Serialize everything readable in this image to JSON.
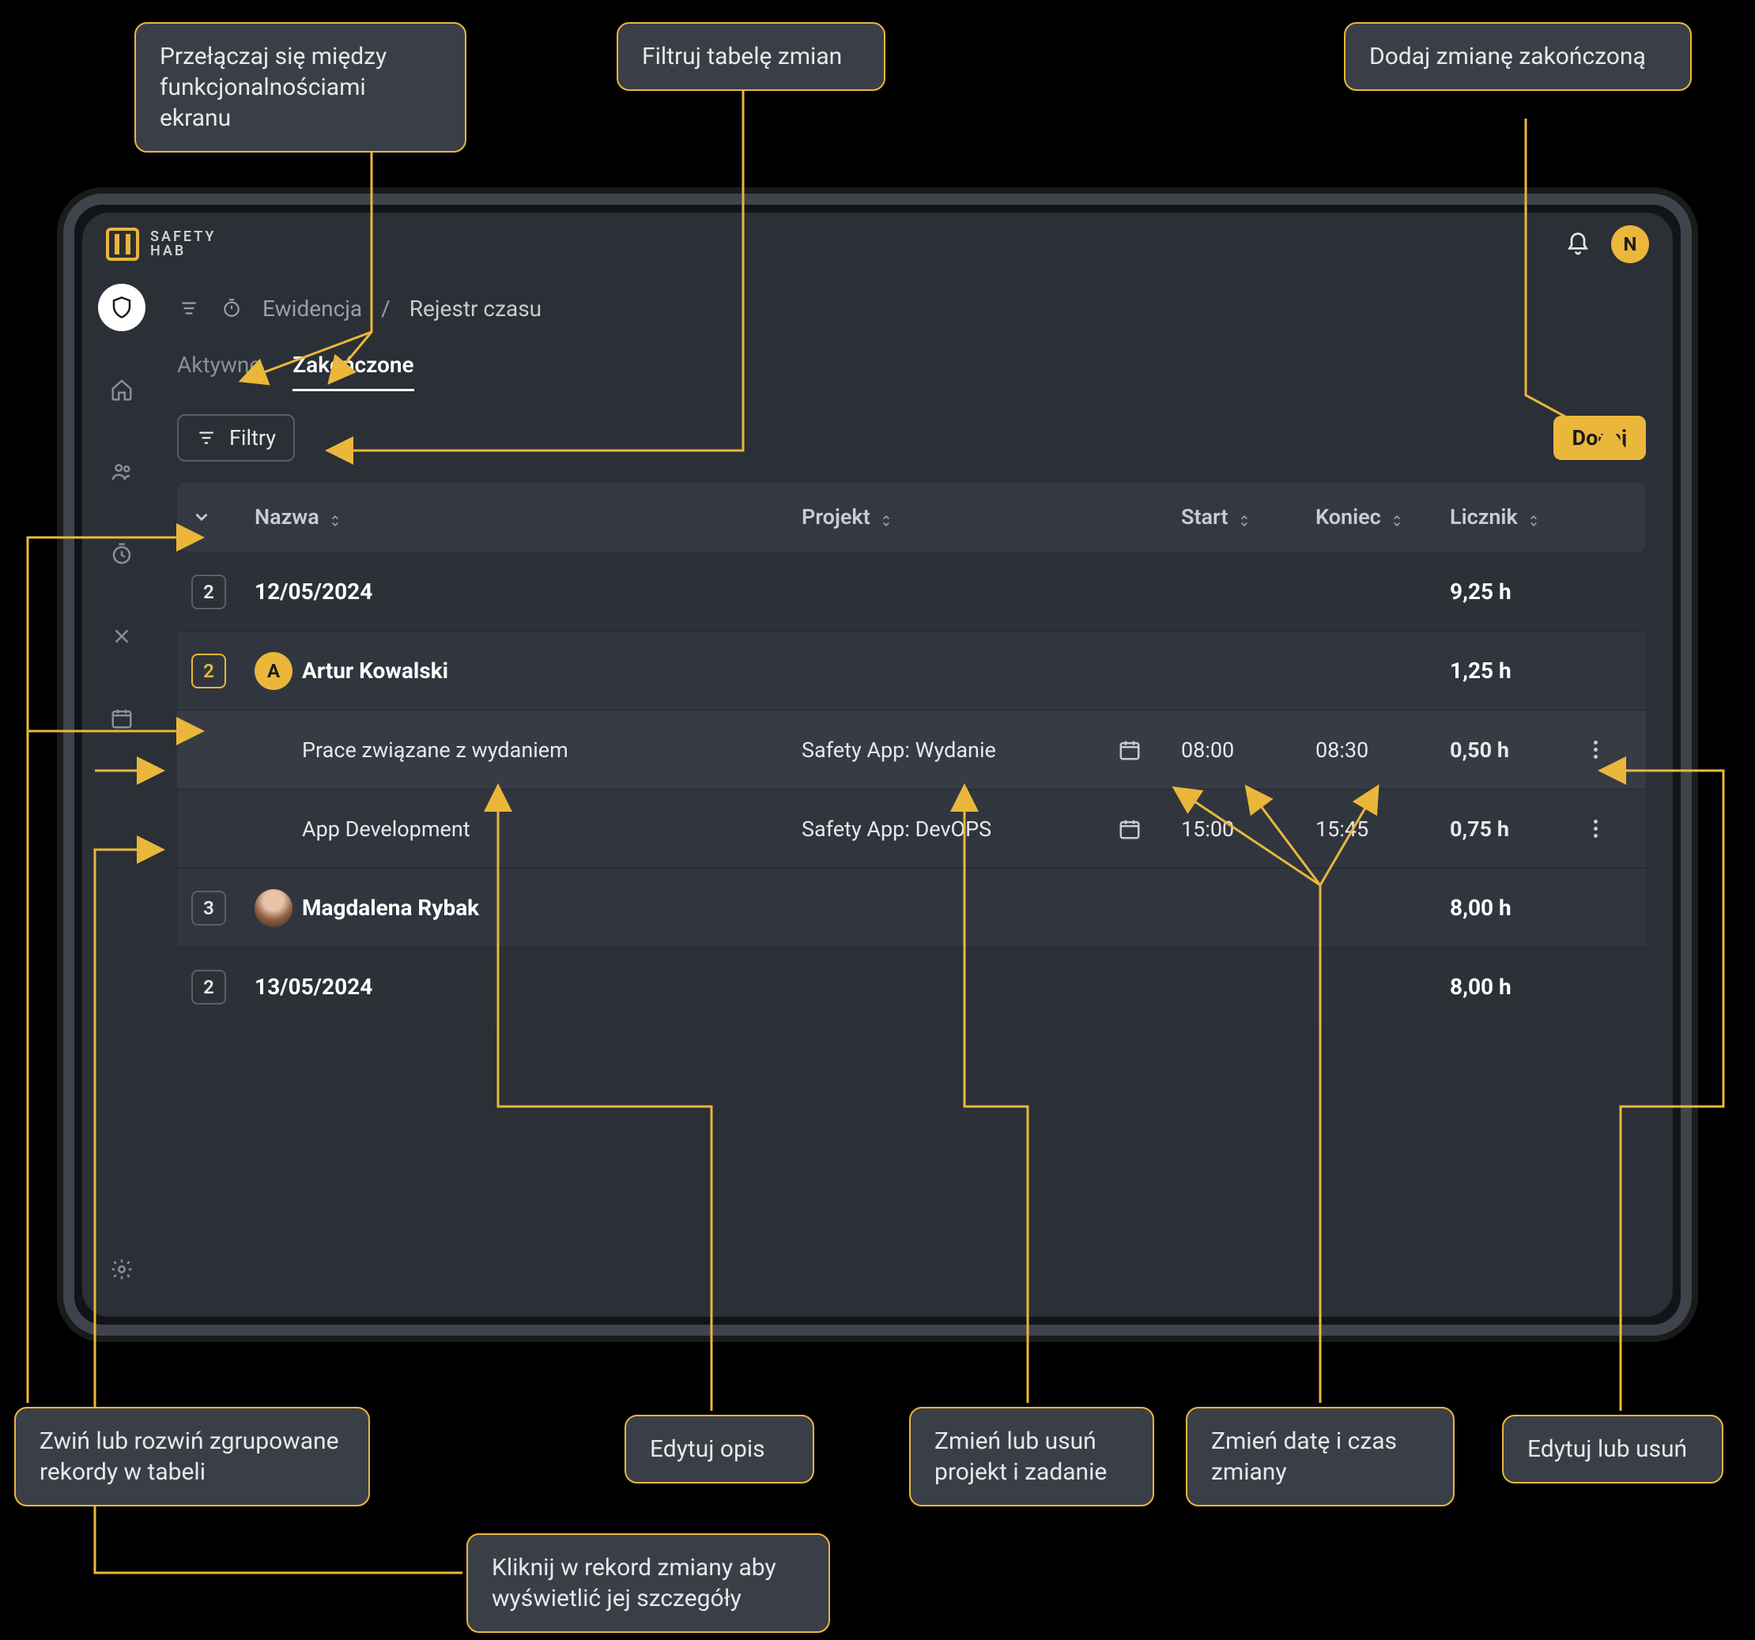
{
  "callouts": {
    "switch_tabs": "Przełączaj się między funkcjonalnościami ekranu",
    "filter": "Filtruj tabelę zmian",
    "add": "Dodaj zmianę zakończoną",
    "collapse": "Zwiń lub rozwiń zgrupowane rekordy w tabeli",
    "edit_desc": "Edytuj opis",
    "change_proj": "Zmień lub usuń projekt i zadanie",
    "change_date": "Zmień datę i czas zmiany",
    "edit_delete": "Edytuj lub usuń",
    "click_record": "Kliknij w rekord zmiany aby wyświetlić jej szczegóły"
  },
  "appbar": {
    "brand1": "SAFETY",
    "brand2": "HAB",
    "user_initial": "N"
  },
  "breadcrumb": {
    "a": "Ewidencja",
    "b": "Rejestr czasu"
  },
  "tabs": {
    "active": "Aktywne",
    "done": "Zakończone"
  },
  "toolbar": {
    "filters": "Filtry",
    "add": "Dodaj"
  },
  "columns": {
    "name": "Nazwa",
    "project": "Projekt",
    "start": "Start",
    "end": "Koniec",
    "counter": "Licznik"
  },
  "rows": {
    "g1_badge": "2",
    "g1_date": "12/05/2024",
    "g1_counter": "9,25 h",
    "u1_badge": "2",
    "u1_initial": "A",
    "u1_name": "Artur Kowalski",
    "u1_counter": "1,25 h",
    "e1_name": "Prace związane z wydaniem",
    "e1_project": "Safety App: Wydanie",
    "e1_start": "08:00",
    "e1_end": "08:30",
    "e1_counter": "0,50 h",
    "e2_name": "App Development",
    "e2_project": "Safety App: DevOPS",
    "e2_start": "15:00",
    "e2_end": "15:45",
    "e2_counter": "0,75 h",
    "u2_badge": "3",
    "u2_name": "Magdalena Rybak",
    "u2_counter": "8,00 h",
    "g2_badge": "2",
    "g2_date": "13/05/2024",
    "g2_counter": "8,00 h"
  }
}
